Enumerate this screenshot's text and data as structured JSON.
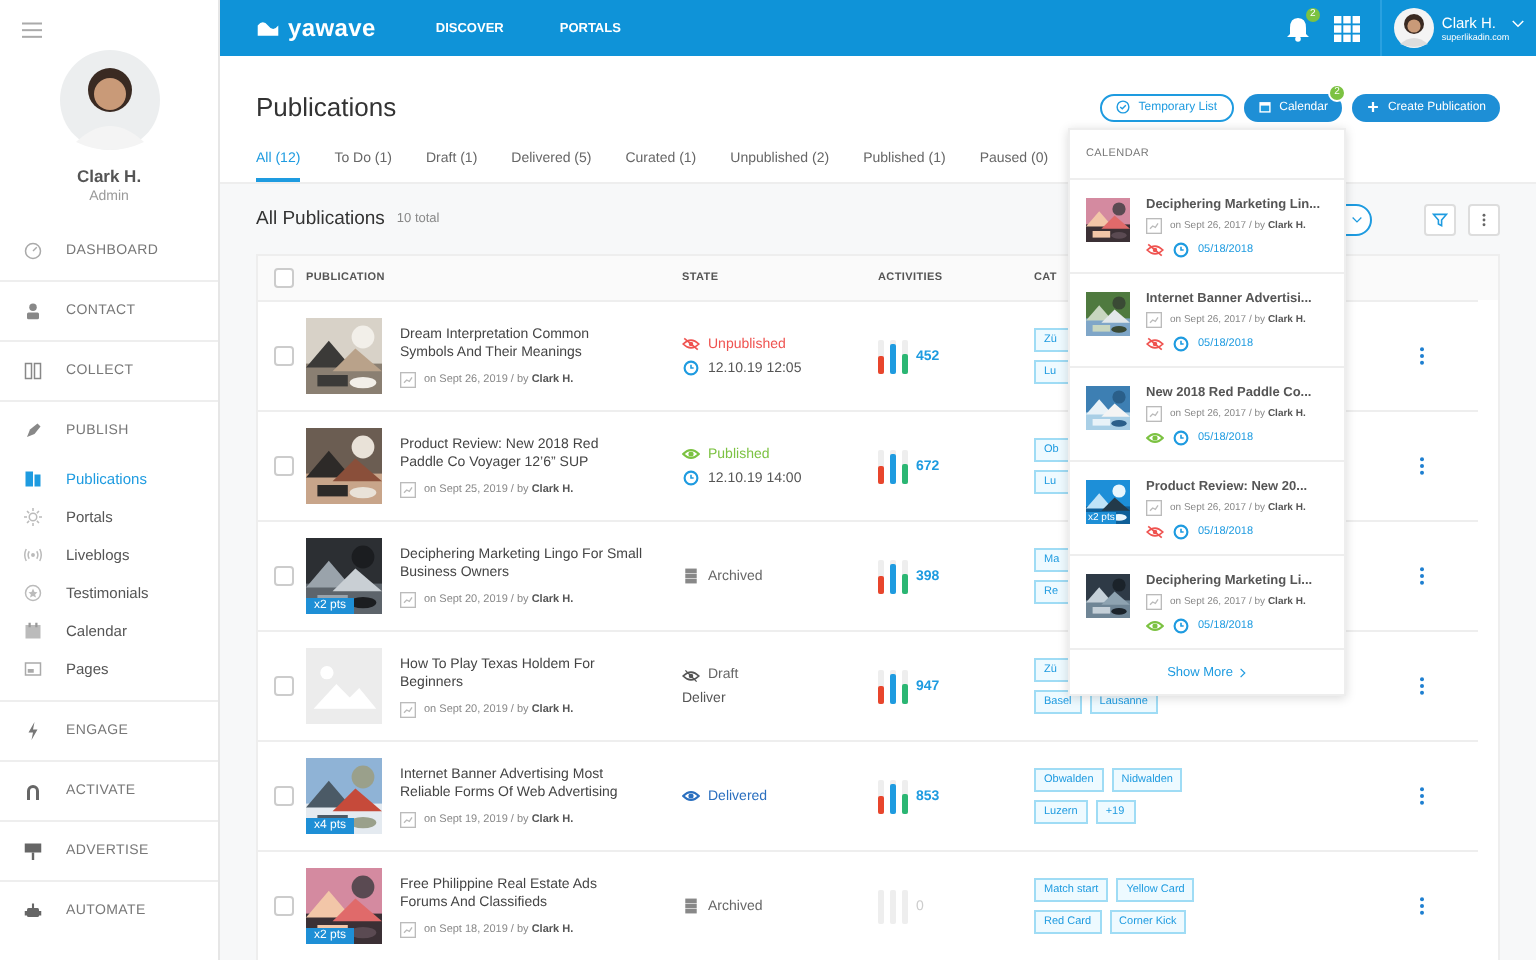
{
  "sidebar": {
    "user": {
      "name": "Clark H.",
      "role": "Admin"
    },
    "items": [
      {
        "kind": "section",
        "label": "DASHBOARD",
        "selected": false
      },
      {
        "kind": "section",
        "label": "CONTACT",
        "selected": false
      },
      {
        "kind": "section",
        "label": "COLLECT",
        "selected": false
      },
      {
        "kind": "section",
        "label": "PUBLISH",
        "selected": false
      },
      {
        "kind": "sub",
        "label": "Publications",
        "selected": true
      },
      {
        "kind": "sub",
        "label": "Portals",
        "selected": false
      },
      {
        "kind": "sub",
        "label": "Liveblogs",
        "selected": false
      },
      {
        "kind": "sub",
        "label": "Testimonials",
        "selected": false
      },
      {
        "kind": "sub",
        "label": "Calendar",
        "selected": false
      },
      {
        "kind": "sub",
        "label": "Pages",
        "selected": false
      },
      {
        "kind": "section",
        "label": "ENGAGE",
        "selected": false
      },
      {
        "kind": "section",
        "label": "ACTIVATE",
        "selected": false
      },
      {
        "kind": "section",
        "label": "ADVERTISE",
        "selected": false
      },
      {
        "kind": "section",
        "label": "AUTOMATE",
        "selected": false
      }
    ]
  },
  "topbar": {
    "logo": "yawave",
    "nav": [
      "DISCOVER",
      "PORTALS"
    ],
    "notifications": "2",
    "user": {
      "name": "Clark H.",
      "email": "superlikadin.com"
    }
  },
  "page": {
    "title": "Publications",
    "buttons": [
      {
        "kind": "outline",
        "label": "Temporary List"
      },
      {
        "kind": "filled",
        "label": "Calendar",
        "badge": "2"
      },
      {
        "kind": "filled",
        "label": "Create Publication"
      }
    ],
    "tabs": [
      {
        "label": "All (12)",
        "selected": true
      },
      {
        "label": "To Do (1)",
        "selected": false
      },
      {
        "label": "Draft (1)",
        "selected": false
      },
      {
        "label": "Delivered (5)",
        "selected": false
      },
      {
        "label": "Curated (1)",
        "selected": false
      },
      {
        "label": "Unpublished (2)",
        "selected": false
      },
      {
        "label": "Published (1)",
        "selected": false
      },
      {
        "label": "Paused (0)",
        "selected": false
      }
    ]
  },
  "list": {
    "title": "All Publications",
    "count": "10 total"
  },
  "table": {
    "all_checked": false,
    "columns": [
      "PUBLICATION",
      "STATE",
      "ACTIVITIES",
      "CAT"
    ],
    "rows": [
      {
        "checked": false,
        "thumb": {
          "kind": "picture"
        },
        "title": "Dream Interpretation Common Symbols And Their Meanings",
        "meta": "on Sept 26, 2019 / by **Clark H.**",
        "state": {
          "kind": "unpublished",
          "label": "Unpublished",
          "time": "12.10.19 12:05"
        },
        "activity": "452",
        "bars": [
          {
            "color": "#e8452c",
            "level": 0.5
          },
          {
            "color": "#1e9be0",
            "level": 0.85
          },
          {
            "color": "#2bb673",
            "level": 0.55
          }
        ],
        "tag_lines": [
          [
            "Zü"
          ],
          [
            "Lu"
          ]
        ]
      },
      {
        "checked": false,
        "thumb": {
          "kind": "picture"
        },
        "title": "Product Review: New 2018 Red Paddle Co Voyager 12’6” SUP",
        "meta": "on Sept 25, 2019 / by **Clark H.**",
        "state": {
          "kind": "published",
          "label": "Published",
          "time": "12.10.19 14:00"
        },
        "activity": "672",
        "bars": [
          {
            "color": "#e8452c",
            "level": 0.5
          },
          {
            "color": "#1e9be0",
            "level": 0.85
          },
          {
            "color": "#2bb673",
            "level": 0.55
          }
        ],
        "tag_lines": [
          [
            "Ob"
          ],
          [
            "Lu"
          ]
        ]
      },
      {
        "checked": false,
        "thumb": {
          "kind": "picture"
        },
        "pts": "x2 pts",
        "title": "Deciphering Marketing Lingo For Small Business Owners",
        "meta": "on Sept 20, 2019 / by **Clark H.**",
        "state": {
          "kind": "archived",
          "label": "Archived"
        },
        "activity": "398",
        "bars": [
          {
            "color": "#e8452c",
            "level": 0.5
          },
          {
            "color": "#1e9be0",
            "level": 0.85
          },
          {
            "color": "#2bb673",
            "level": 0.55
          }
        ],
        "tag_lines": [
          [
            "Ma"
          ],
          [
            "Re"
          ]
        ]
      },
      {
        "checked": false,
        "thumb": {
          "kind": "placeholder"
        },
        "title": "How To Play Texas Holdem For Beginners",
        "meta": "on Sept 20, 2019 / by **Clark H.**",
        "state": {
          "kind": "draft",
          "label": "Draft",
          "time": "Deliver"
        },
        "activity": "947",
        "bars": [
          {
            "color": "#e8452c",
            "level": 0.5
          },
          {
            "color": "#1e9be0",
            "level": 0.85
          },
          {
            "color": "#2bb673",
            "level": 0.55
          }
        ],
        "tag_lines": [
          [
            "Zü"
          ],
          [
            "Basel",
            "Lausanne"
          ]
        ]
      },
      {
        "checked": false,
        "thumb": {
          "kind": "picture"
        },
        "pts": "x4 pts",
        "title": "Internet Banner Advertising Most Reliable Forms Of Web Advertising",
        "meta": "on Sept 19, 2019 / by **Clark H.**",
        "state": {
          "kind": "delivered",
          "label": "Delivered"
        },
        "activity": "853",
        "bars": [
          {
            "color": "#e8452c",
            "level": 0.5
          },
          {
            "color": "#1e9be0",
            "level": 0.85
          },
          {
            "color": "#2bb673",
            "level": 0.55
          }
        ],
        "tag_lines": [
          [
            "Obwalden",
            "Nidwalden"
          ],
          [
            "Luzern",
            "+19"
          ]
        ]
      },
      {
        "checked": false,
        "thumb": {
          "kind": "picture"
        },
        "pts": "x2 pts",
        "title": "Free Philippine Real Estate Ads Forums And Classifieds",
        "meta": "on Sept 18, 2019 / by **Clark H.**",
        "state": {
          "kind": "archived",
          "label": "Archived"
        },
        "activity": "0",
        "bars": [
          {
            "level": 0
          },
          {
            "level": 0
          },
          {
            "level": 0
          }
        ],
        "tag_lines": [
          [
            "Match start",
            "Yellow Card"
          ],
          [
            "Red Card",
            "Corner Kick"
          ]
        ]
      }
    ]
  },
  "calendar": {
    "title": "CALENDAR",
    "items": [
      {
        "title": "Deciphering Marketing Lin...",
        "meta": "on Sept 26, 2017 / by **Clark H.**",
        "published": false,
        "date": "05/18/2018"
      },
      {
        "title": "Internet Banner Advertisi...",
        "meta": "on Sept 26, 2017 / by **Clark H.**",
        "published": false,
        "date": "05/18/2018"
      },
      {
        "title": "New 2018 Red Paddle Co...",
        "meta": "on Sept 26, 2017 / by **Clark H.**",
        "published": true,
        "date": "05/18/2018"
      },
      {
        "title": "Product Review: New 20...",
        "pts": "x2 pts",
        "meta": "on Sept 26, 2017 / by **Clark H.**",
        "published": false,
        "date": "05/18/2018"
      },
      {
        "title": "Deciphering Marketing Li...",
        "meta": "on Sept 26, 2017 / by **Clark H.**",
        "published": true,
        "date": "05/18/2018"
      }
    ],
    "show_more": "Show More"
  }
}
